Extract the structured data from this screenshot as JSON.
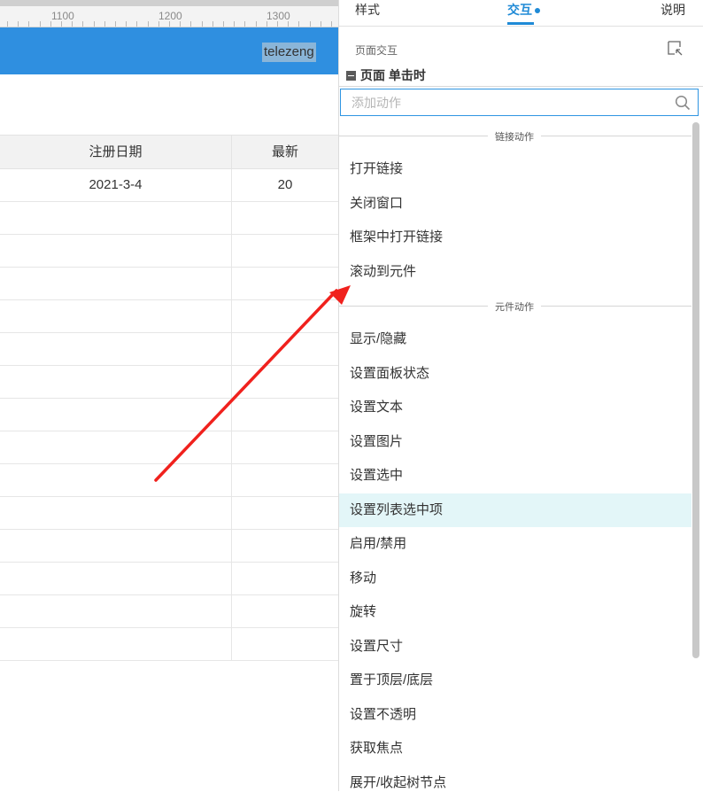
{
  "ruler": {
    "labels": [
      "1100",
      "1200",
      "1300"
    ]
  },
  "header": {
    "username": "telezeng"
  },
  "table": {
    "columns": [
      "注册日期",
      "最新"
    ],
    "rows": [
      [
        "2021-3-4",
        "20"
      ],
      [
        "",
        ""
      ],
      [
        "",
        ""
      ],
      [
        "",
        ""
      ],
      [
        "",
        ""
      ],
      [
        "",
        ""
      ],
      [
        "",
        ""
      ],
      [
        "",
        ""
      ],
      [
        "",
        ""
      ],
      [
        "",
        ""
      ],
      [
        "",
        ""
      ],
      [
        "",
        ""
      ],
      [
        "",
        ""
      ],
      [
        "",
        ""
      ],
      [
        "",
        ""
      ]
    ]
  },
  "panel": {
    "tabs": {
      "style": "样式",
      "interaction": "交互",
      "notes": "说明"
    },
    "section_label": "页面交互",
    "event_label": "页面 单击时",
    "search_placeholder": "添加动作",
    "groups": [
      {
        "title": "链接动作",
        "items": [
          "打开链接",
          "关闭窗口",
          "框架中打开链接",
          "滚动到元件"
        ]
      },
      {
        "title": "元件动作",
        "items": [
          "显示/隐藏",
          "设置面板状态",
          "设置文本",
          "设置图片",
          "设置选中",
          "设置列表选中项",
          "启用/禁用",
          "移动",
          "旋转",
          "设置尺寸",
          "置于顶层/底层",
          "设置不透明",
          "获取焦点",
          "展开/收起树节点"
        ]
      }
    ],
    "highlighted_item": "设置列表选中项"
  },
  "colors": {
    "accent": "#1f8ad6",
    "header_blue": "#2f8fe0",
    "highlight": "#e3f6f8",
    "arrow": "#f0211d"
  }
}
